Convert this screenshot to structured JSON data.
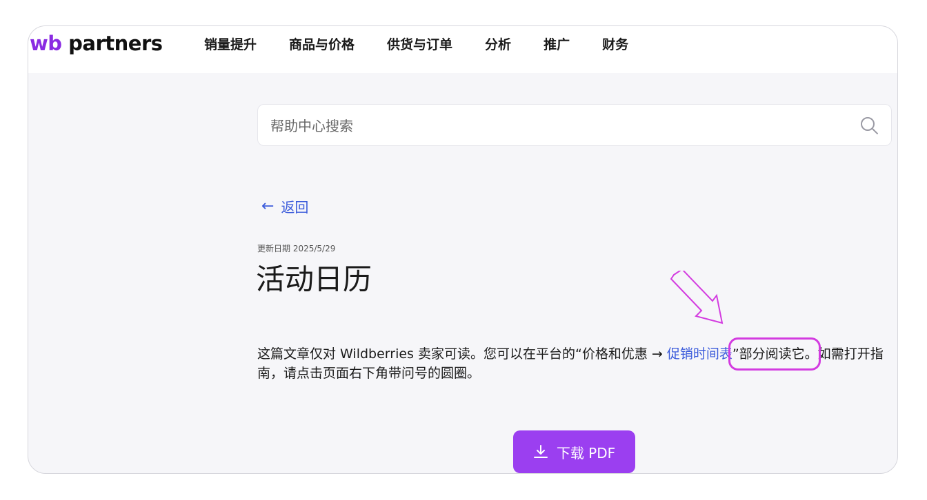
{
  "logo": {
    "prefix": "wb",
    "name": "partners"
  },
  "nav": [
    "销量提升",
    "商品与价格",
    "供货与订单",
    "分析",
    "推广",
    "财务"
  ],
  "search": {
    "placeholder": "帮助中心搜索"
  },
  "back_label": "返回",
  "updated": "更新日期 2025/5/29",
  "title": "活动日历",
  "body": {
    "before_link": "这篇文章仅对 Wildberries 卖家可读。您可以在平台的“价格和优惠 → ",
    "link": "促销时间表",
    "after_link": "”部分阅读它。如需打开指南，请点击页面右下角带问号的圆圈。"
  },
  "download_label": "下载 PDF",
  "colors": {
    "accent": "#9b3ff0",
    "link": "#3b5bdb",
    "highlight": "#d33be0"
  }
}
